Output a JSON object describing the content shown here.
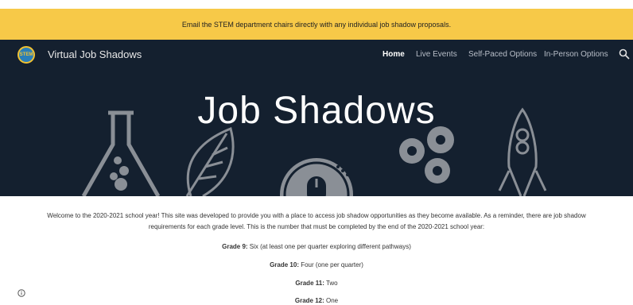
{
  "banner": {
    "text": "Email the STEM department chairs directly with any individual job shadow proposals."
  },
  "site": {
    "title": "Virtual Job Shadows",
    "logo_text": "STEM"
  },
  "nav": {
    "items": [
      {
        "label": "Home"
      },
      {
        "label": "Live Events"
      },
      {
        "label": "Self-Paced Options"
      },
      {
        "label": "In-Person Options"
      }
    ]
  },
  "hero": {
    "title": "Job Shadows"
  },
  "content": {
    "intro": "Welcome to the 2020-2021 school year! This site was developed to provide you with a place to access job shadow opportunities as they become available.  As a reminder, there are job shadow requirements for each grade level. This is the number that must be completed by the end of the 2020-2021 school year:",
    "grades": [
      {
        "label": "Grade 9:",
        "value": " Six (at least one per quarter exploring different pathways)"
      },
      {
        "label": "Grade 10:",
        "value": " Four (one per quarter)"
      },
      {
        "label": "Grade 11:",
        "value": " Two"
      },
      {
        "label": "Grade 12:",
        "value": " One"
      }
    ]
  }
}
